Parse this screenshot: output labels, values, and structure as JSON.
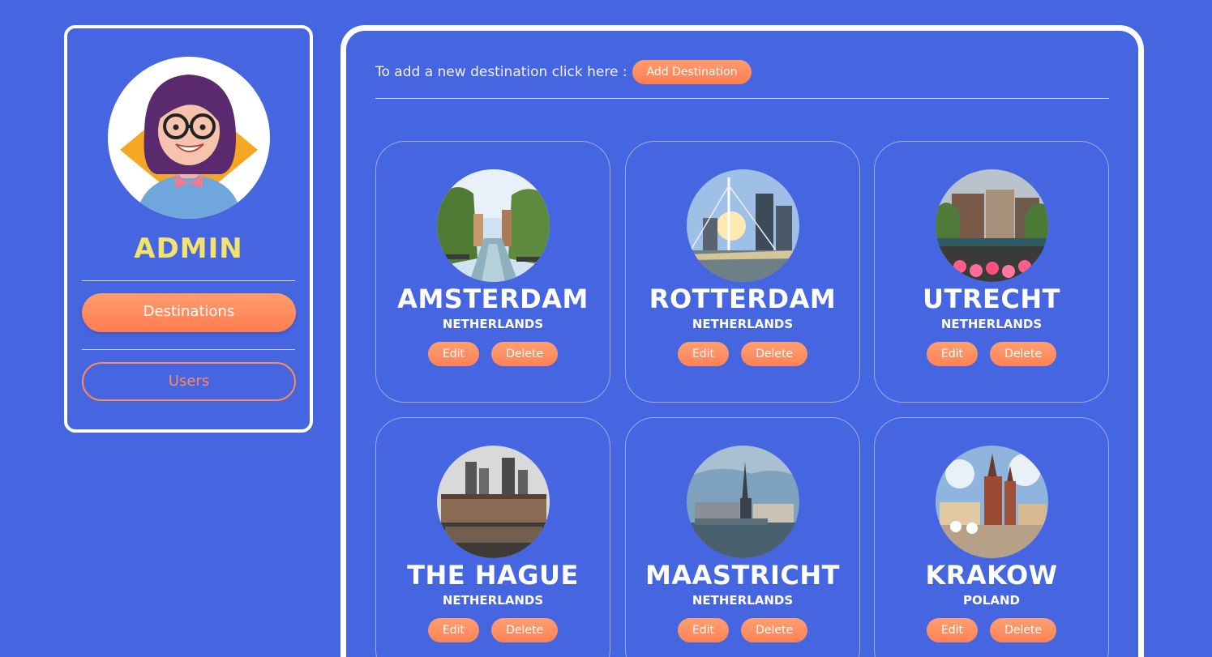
{
  "sidebar": {
    "role_title": "ADMIN",
    "nav": {
      "destinations_label": "Destinations",
      "users_label": "Users"
    }
  },
  "main": {
    "add_prompt": "To add a new destination click here :",
    "add_button_label": "Add Destination",
    "edit_label": "Edit",
    "delete_label": "Delete",
    "destinations": [
      {
        "city": "AMSTERDAM",
        "country": "NETHERLANDS"
      },
      {
        "city": "ROTTERDAM",
        "country": "NETHERLANDS"
      },
      {
        "city": "UTRECHT",
        "country": "NETHERLANDS"
      },
      {
        "city": "THE HAGUE",
        "country": "NETHERLANDS"
      },
      {
        "city": "MAASTRICHT",
        "country": "NETHERLANDS"
      },
      {
        "city": "KRAKOW",
        "country": "POLAND"
      }
    ]
  },
  "colors": {
    "background": "#4665e0",
    "accent_orange": "#ff8a5b",
    "admin_yellow": "#f3e26b",
    "border_white": "#ffffff"
  }
}
